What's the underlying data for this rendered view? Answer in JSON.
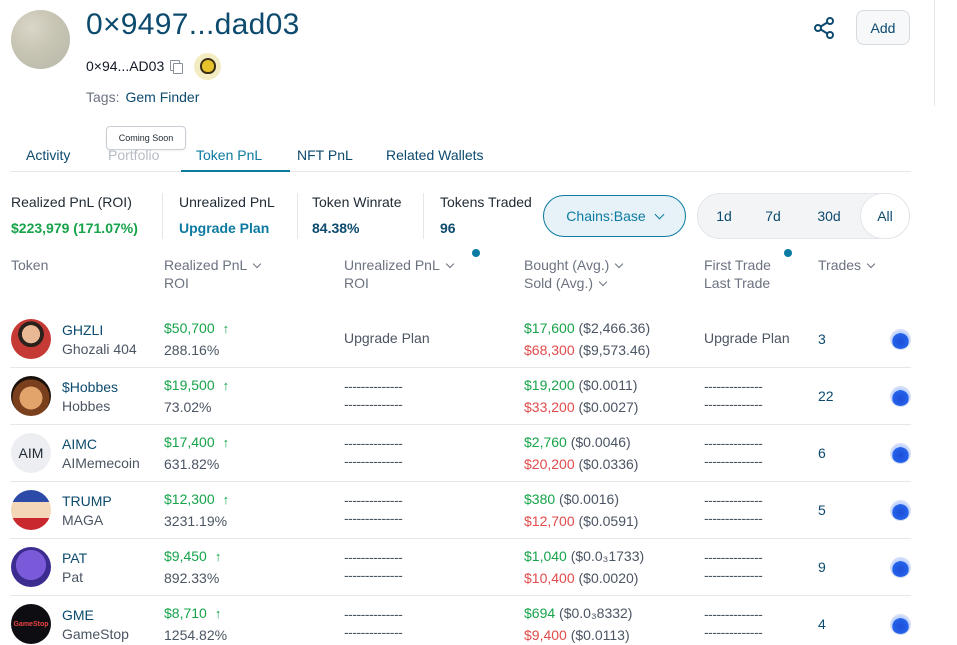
{
  "header": {
    "title": "0×9497...dad03",
    "address_short": "0×94...AD03",
    "tags_label": "Tags:",
    "tag": "Gem Finder",
    "add_label": "Add",
    "share_icon": "share-icon",
    "copy_icon": "copy-icon"
  },
  "tabs": {
    "items": [
      "Activity",
      "Portfolio",
      "Token PnL",
      "NFT PnL",
      "Related Wallets"
    ],
    "active": "Token PnL",
    "tooltip": "Coming Soon"
  },
  "stats": {
    "realized_label": "Realized PnL (ROI)",
    "realized_value": "$223,979 (171.07%)",
    "unrealized_label": "Unrealized PnL",
    "unrealized_value": "Upgrade Plan",
    "winrate_label": "Token Winrate",
    "winrate_value": "84.38%",
    "traded_label": "Tokens Traded",
    "traded_value": "96"
  },
  "filters": {
    "chains_label": "Chains:",
    "chains_value": "Base",
    "ranges": [
      "1d",
      "7d",
      "30d",
      "All"
    ],
    "active_range": "All"
  },
  "columns": {
    "token": "Token",
    "realized_pnl": "Realized PnL",
    "roi": "ROI",
    "unrealized_pnl": "Unrealized PnL",
    "unrealized_roi": "ROI",
    "bought": "Bought (Avg.)",
    "sold": "Sold (Avg.)",
    "first_trade": "First Trade",
    "last_trade": "Last Trade",
    "trades": "Trades"
  },
  "rows": [
    {
      "symbol": "GHZLI",
      "name": "Ghozali 404",
      "avatar_text": "",
      "pnl": "$50,700",
      "roi": "288.16%",
      "unrealized_a": "Upgrade Plan",
      "unrealized_b": "",
      "bought": "$17,600",
      "bought_avg": "($2,466.36)",
      "sold": "$68,300",
      "sold_avg": "($9,573.46)",
      "first_trade": "Upgrade Plan",
      "last_trade": "",
      "trades": "3"
    },
    {
      "symbol": "$Hobbes",
      "name": "Hobbes",
      "avatar_text": "",
      "pnl": "$19,500",
      "roi": "73.02%",
      "unrealized_a": "--------------",
      "unrealized_b": "--------------",
      "bought": "$19,200",
      "bought_avg": "($0.0011)",
      "sold": "$33,200",
      "sold_avg": "($0.0027)",
      "first_trade": "--------------",
      "last_trade": "--------------",
      "trades": "22"
    },
    {
      "symbol": "AIMC",
      "name": "AIMemecoin",
      "avatar_text": "AIM",
      "pnl": "$17,400",
      "roi": "631.82%",
      "unrealized_a": "--------------",
      "unrealized_b": "--------------",
      "bought": "$2,760",
      "bought_avg": "($0.0046)",
      "sold": "$20,200",
      "sold_avg": "($0.0336)",
      "first_trade": "--------------",
      "last_trade": "--------------",
      "trades": "6"
    },
    {
      "symbol": "TRUMP",
      "name": "MAGA",
      "avatar_text": "",
      "pnl": "$12,300",
      "roi": "3231.19%",
      "unrealized_a": "--------------",
      "unrealized_b": "--------------",
      "bought": "$380",
      "bought_avg": "($0.0016)",
      "sold": "$12,700",
      "sold_avg": "($0.0591)",
      "first_trade": "--------------",
      "last_trade": "--------------",
      "trades": "5"
    },
    {
      "symbol": "PAT",
      "name": "Pat",
      "avatar_text": "",
      "pnl": "$9,450",
      "roi": "892.33%",
      "unrealized_a": "--------------",
      "unrealized_b": "--------------",
      "bought": "$1,040",
      "bought_avg": "($0.0₃1733)",
      "sold": "$10,400",
      "sold_avg": "($0.0020)",
      "first_trade": "--------------",
      "last_trade": "--------------",
      "trades": "9"
    },
    {
      "symbol": "GME",
      "name": "GameStop",
      "avatar_text": "GameStop",
      "pnl": "$8,710",
      "roi": "1254.82%",
      "unrealized_a": "--------------",
      "unrealized_b": "--------------",
      "bought": "$694",
      "bought_avg": "($0.0₃8332)",
      "sold": "$9,400",
      "sold_avg": "($0.0113)",
      "first_trade": "--------------",
      "last_trade": "--------------",
      "trades": "4"
    }
  ],
  "colors": {
    "navy": "#0c4a6e",
    "accent": "#0c7aa1",
    "profit": "#16a34a",
    "loss": "#e14b4b"
  }
}
